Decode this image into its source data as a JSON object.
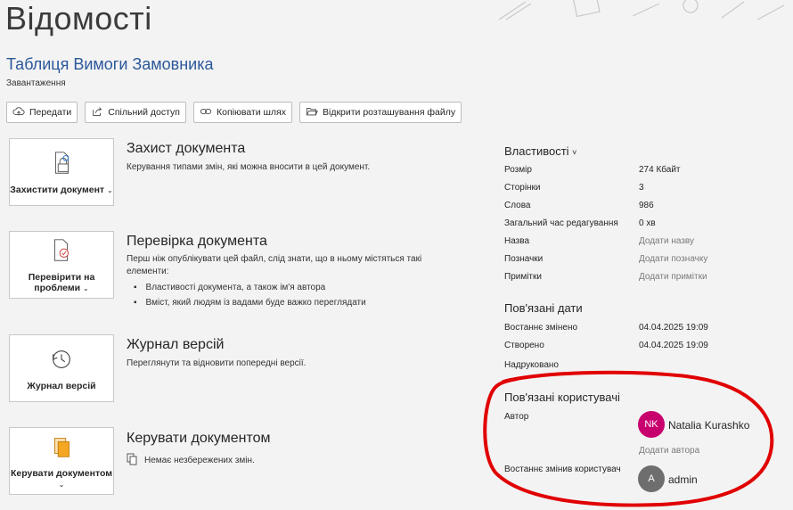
{
  "page": {
    "title": "Відомості",
    "document_title": "Таблиця Вимоги Замовника",
    "document_path": "Завантаження"
  },
  "toolbar": {
    "upload": {
      "label": "Передати",
      "icon": "cloud-upload-icon"
    },
    "share": {
      "label": "Спільний доступ",
      "icon": "share-icon"
    },
    "copy_path": {
      "label": "Копіювати шлях",
      "icon": "link-icon"
    },
    "open_location": {
      "label": "Відкрити розташування файлу",
      "icon": "folder-open-icon"
    }
  },
  "sections": [
    {
      "button_label": "Захистити документ",
      "button_icon": "lock-document-icon",
      "heading": "Захист документа",
      "description": "Керування типами змін, які можна вносити в цей документ."
    },
    {
      "button_label": "Перевірити на проблеми",
      "button_icon": "inspect-document-icon",
      "heading": "Перевірка документа",
      "description": "Перш ніж опублікувати цей файл, слід знати, що в ньому містяться такі елементи:",
      "bullets": [
        "Властивості документа, а також ім'я автора",
        "Вміст, який людям із вадами буде важко переглядати"
      ]
    },
    {
      "button_label": "Журнал версій",
      "button_icon": "history-clock-icon",
      "heading": "Журнал версій",
      "description": "Переглянути та відновити попередні версії."
    },
    {
      "button_label": "Керувати документом",
      "button_icon": "manage-document-icon",
      "heading": "Керувати документом",
      "description": "Немає незбережених змін."
    }
  ],
  "properties": {
    "heading": "Властивості",
    "heading_chevron": "˅",
    "rows": [
      {
        "label": "Розмір",
        "value": "274 Кбайт"
      },
      {
        "label": "Сторінки",
        "value": "3"
      },
      {
        "label": "Слова",
        "value": "986"
      },
      {
        "label": "Загальний час редагування",
        "value": "0 хв"
      },
      {
        "label": "Назва",
        "value": "Додати назву"
      },
      {
        "label": "Позначки",
        "value": "Додати позначку"
      },
      {
        "label": "Примітки",
        "value": "Додати примітки"
      }
    ]
  },
  "related_dates": {
    "heading": "Пов'язані дати",
    "rows": [
      {
        "label": "Востаннє змінено",
        "value": "04.04.2025 19:09"
      },
      {
        "label": "Створено",
        "value": "04.04.2025 19:09"
      },
      {
        "label": "Надруковано",
        "value": ""
      }
    ]
  },
  "related_people": {
    "heading": "Пов'язані користувачі",
    "author_label": "Автор",
    "author": {
      "initials": "NK",
      "name": "Natalia Kurashko",
      "color": "#c8006e"
    },
    "add_author": "Додати автора",
    "last_modified_label": "Востаннє змінив користувач",
    "last_modified_by": {
      "initials": "A",
      "name": "admin",
      "color": "#6e6e6e"
    }
  },
  "annotation_color": "#e10000"
}
